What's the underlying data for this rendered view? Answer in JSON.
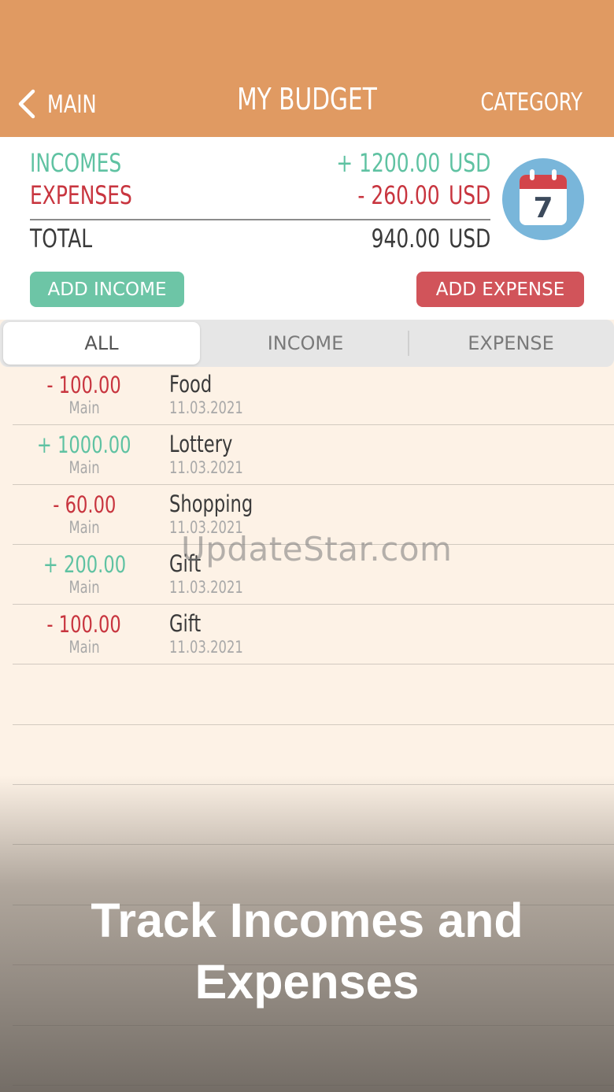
{
  "header": {
    "back_label": "MAIN",
    "title": "MY BUDGET",
    "category_label": "CATEGORY"
  },
  "summary": {
    "incomes": {
      "label": "INCOMES",
      "amount": "+ 1200.00",
      "currency": "USD"
    },
    "expenses": {
      "label": "EXPENSES",
      "amount": "- 260.00",
      "currency": "USD"
    },
    "total": {
      "label": "TOTAL",
      "amount": "940.00",
      "currency": "USD"
    },
    "calendar_day": "7",
    "add_income_label": "ADD INCOME",
    "add_expense_label": "ADD EXPENSE"
  },
  "tabs": [
    {
      "label": "ALL",
      "selected": true
    },
    {
      "label": "INCOME",
      "selected": false
    },
    {
      "label": "EXPENSE",
      "selected": false
    }
  ],
  "transactions": [
    {
      "amount": "- 100.00",
      "type": "expense",
      "account": "Main",
      "name": "Food",
      "date": "11.03.2021"
    },
    {
      "amount": "+ 1000.00",
      "type": "income",
      "account": "Main",
      "name": "Lottery",
      "date": "11.03.2021"
    },
    {
      "amount": "- 60.00",
      "type": "expense",
      "account": "Main",
      "name": "Shopping",
      "date": "11.03.2021"
    },
    {
      "amount": "+ 200.00",
      "type": "income",
      "account": "Main",
      "name": "Gift",
      "date": "11.03.2021"
    },
    {
      "amount": "- 100.00",
      "type": "expense",
      "account": "Main",
      "name": "Gift",
      "date": "11.03.2021"
    }
  ],
  "caption": "Track Incomes and Expenses",
  "watermark": "UpdateStar.com",
  "colors": {
    "header": "#e09a62",
    "income": "#5fc2a2",
    "expense": "#c8353f",
    "list_background": "#fdf2e6"
  }
}
